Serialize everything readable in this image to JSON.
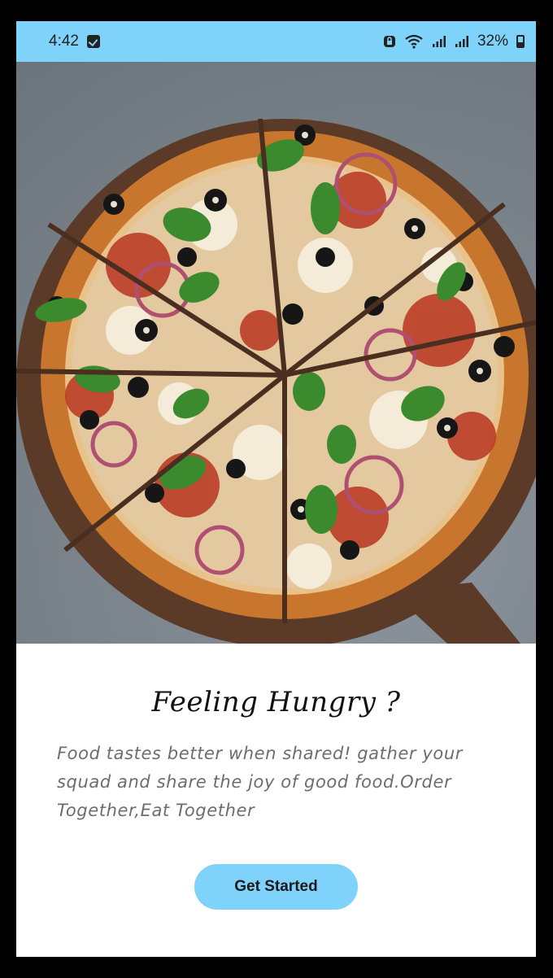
{
  "status_bar": {
    "time": "4:42",
    "battery": "32%",
    "icons": [
      "notification-icon",
      "vpn-lock-icon",
      "wifi-icon",
      "signal-icon",
      "signal-icon",
      "battery-icon"
    ]
  },
  "hero": {
    "image": "pizza-photo"
  },
  "onboarding": {
    "title": "Feeling Hungry ?",
    "description": "Food tastes better when shared! gather your squad and share the joy of good food.Order Together,Eat Together",
    "cta_label": "Get Started"
  },
  "colors": {
    "accent": "#7fd3fb",
    "text_primary": "#111111",
    "text_secondary": "#6d6d6d",
    "background": "#ffffff"
  }
}
